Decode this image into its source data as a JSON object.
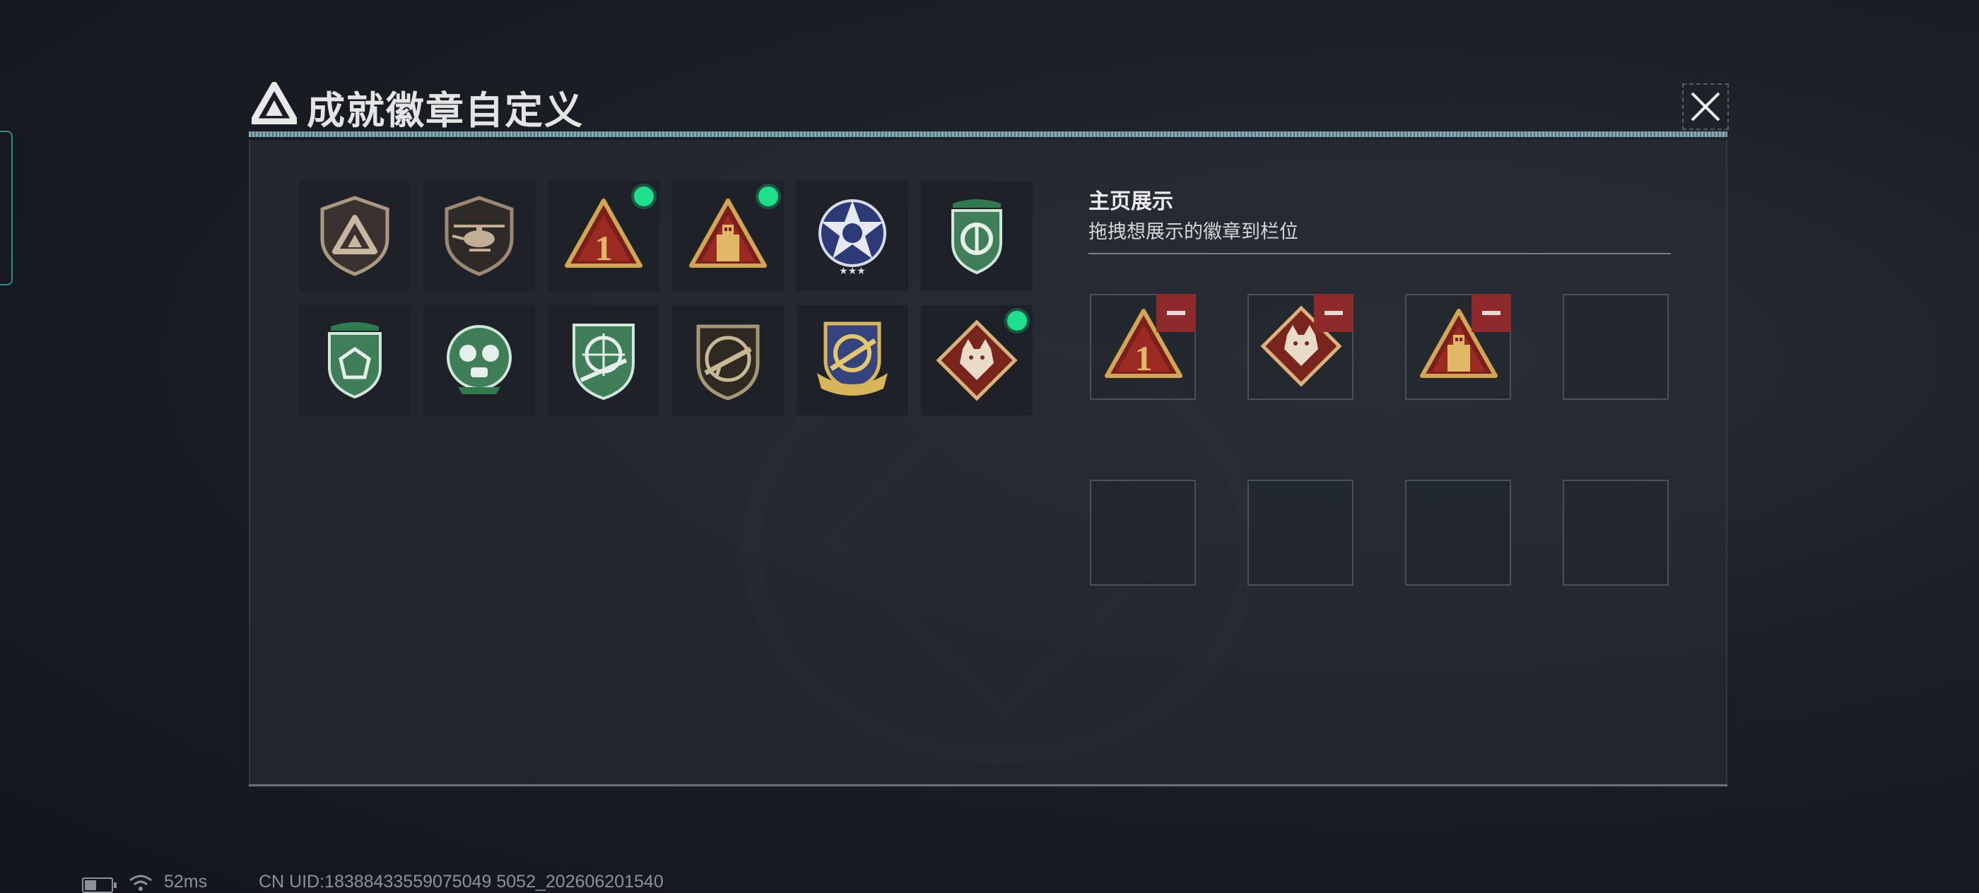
{
  "header": {
    "title": "成就徽章自定义",
    "close_icon": "close-icon"
  },
  "colors": {
    "accent": "#1fe08a",
    "remove": "#8e2a2c",
    "panel": "#282d36"
  },
  "badges": [
    {
      "icon": "triangle-shield-badge",
      "new": false
    },
    {
      "icon": "helicopter-badge",
      "new": false
    },
    {
      "icon": "number-one-triangle-badge",
      "new": true
    },
    {
      "icon": "usb-triangle-badge",
      "new": true
    },
    {
      "icon": "star-wings-badge",
      "new": false
    },
    {
      "icon": "green-shield-emblem-badge",
      "new": false
    },
    {
      "icon": "green-shield-gem-badge",
      "new": false
    },
    {
      "icon": "green-mask-badge",
      "new": false
    },
    {
      "icon": "green-crosshair-rifle-badge",
      "new": false
    },
    {
      "icon": "rifle-target-badge",
      "new": false
    },
    {
      "icon": "gold-blue-rifle-badge",
      "new": false
    },
    {
      "icon": "wolf-diamond-badge",
      "new": true
    }
  ],
  "showcase": {
    "title": "主页展示",
    "subtitle": "拖拽想展示的徽章到栏位",
    "slots": [
      {
        "icon": "number-one-triangle-badge",
        "filled": true
      },
      {
        "icon": "wolf-diamond-badge",
        "filled": true
      },
      {
        "icon": "usb-triangle-badge",
        "filled": true
      },
      {
        "icon": "",
        "filled": false
      },
      {
        "icon": "",
        "filled": false
      },
      {
        "icon": "",
        "filled": false
      },
      {
        "icon": "",
        "filled": false
      },
      {
        "icon": "",
        "filled": false
      }
    ]
  },
  "status": {
    "ping": "52ms",
    "uid": "CN UID:18388433559075049 5052_202606201540"
  }
}
